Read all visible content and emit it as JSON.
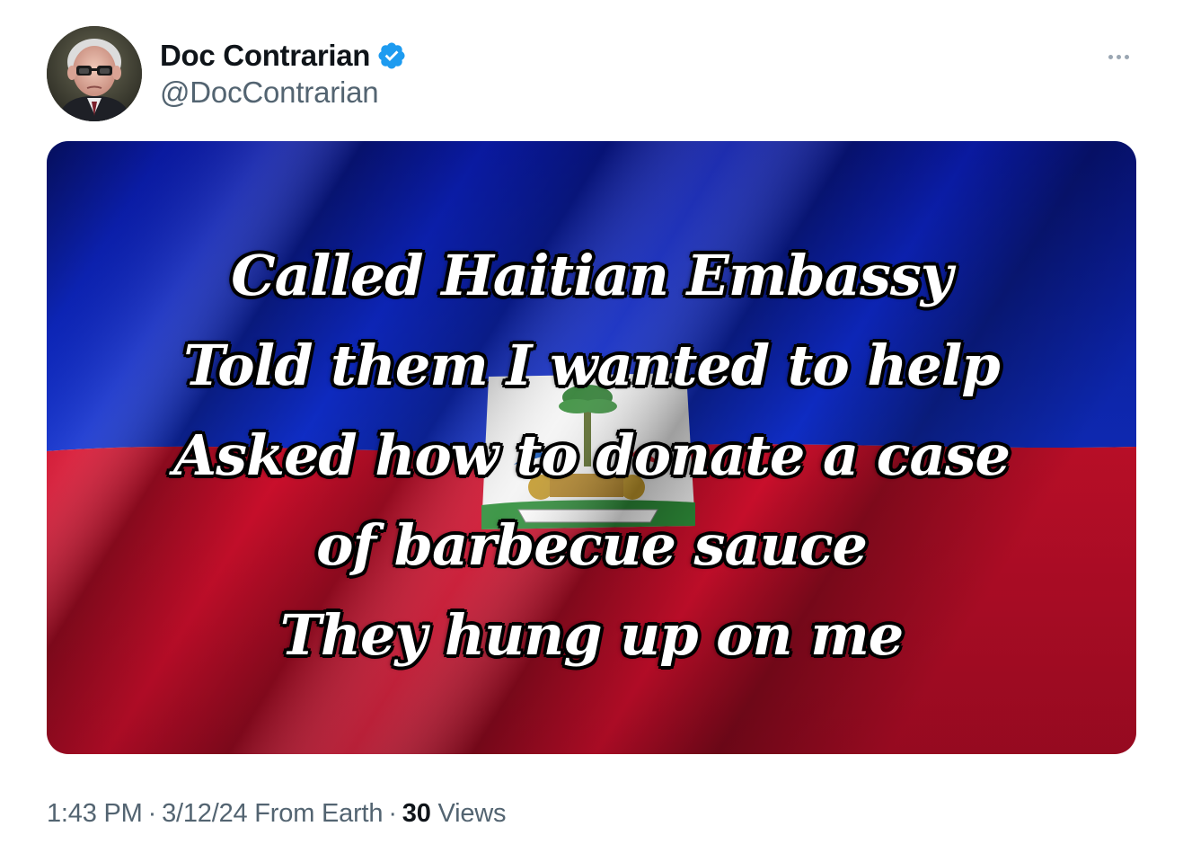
{
  "author": {
    "display_name": "Doc Contrarian",
    "handle": "@DocContrarian",
    "verified": true,
    "verified_color": "#1d9bf0"
  },
  "menu": {
    "more_icon": "more-horizontal-icon"
  },
  "media": {
    "lines": [
      "Called Haitian Embassy",
      "Told them I wanted to help",
      "Asked how to donate a case",
      "of barbecue sauce",
      "They hung up on me"
    ],
    "flag_colors": {
      "blue": "#0a1fb8",
      "red": "#d2102e",
      "white": "#ffffff"
    }
  },
  "meta": {
    "time": "1:43 PM",
    "separator": "·",
    "date": "3/12/24",
    "location": "From Earth",
    "views_count": "30",
    "views_label": "Views"
  }
}
